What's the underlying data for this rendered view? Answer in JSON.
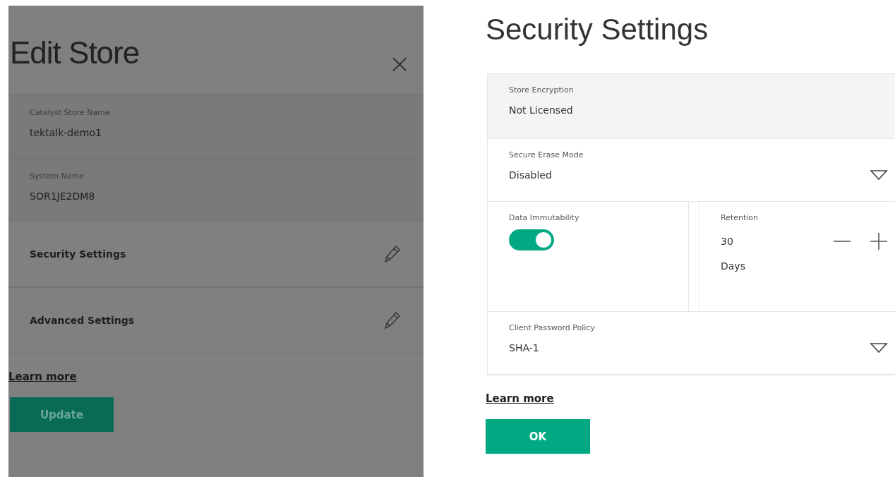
{
  "edit_store": {
    "title": "Edit Store",
    "close": "×",
    "fields": [
      {
        "label": "Catalyst Store Name",
        "value": "tektalk-demo1"
      },
      {
        "label": "System Name",
        "value": "SOR1JE2DM8"
      }
    ],
    "sections": [
      {
        "label": "Security Settings"
      },
      {
        "label": "Advanced Settings"
      }
    ],
    "learn_more": "Learn more",
    "button": "Update"
  },
  "security_settings": {
    "title": "Security Settings",
    "fields": [
      {
        "kind": "readonly",
        "label": "Store Encryption",
        "value": "Not Licensed"
      },
      {
        "kind": "dropdown",
        "label": "Secure Erase Mode",
        "value": "Disabled"
      },
      {
        "kind": "toggle-stepper",
        "toggle": {
          "label": "Data Immutability",
          "on": true
        },
        "stepper": {
          "label": "Retention",
          "value": "30",
          "unit": "Days"
        }
      },
      {
        "kind": "dropdown",
        "label": "Client Password Policy",
        "value": "SHA-1"
      }
    ],
    "learn_more": "Learn more",
    "button": "OK"
  }
}
